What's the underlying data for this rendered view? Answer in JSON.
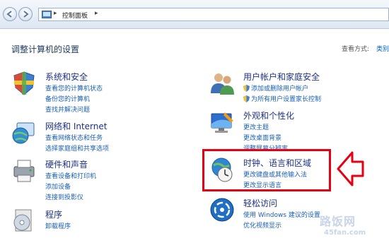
{
  "address": {
    "path": "控制面板",
    "separator": "▸"
  },
  "header": {
    "title": "调整计算机的设置",
    "view_by_label": "查看方式:",
    "view_by_value": "类别"
  },
  "categories": {
    "security": {
      "title": "系统和安全",
      "links": [
        "查看您的计算机状态",
        "备份您的计算机",
        "查找并解决问题"
      ]
    },
    "network": {
      "title": "网络和 Internet",
      "links": [
        "查看网络状态和任务",
        "选择家庭组和共享选项"
      ]
    },
    "hardware": {
      "title": "硬件和声音",
      "links": [
        "查看设备和打印机",
        "添加设备",
        "连接到投影仪"
      ]
    },
    "programs": {
      "title": "程序",
      "links": [
        "卸载程序"
      ]
    },
    "accounts": {
      "title": "用户帐户和家庭安全",
      "links": [
        "添加或删除用户帐户",
        "为所有用户设置家长控制"
      ]
    },
    "appearance": {
      "title": "外观和个性化",
      "links": [
        "更改主题",
        "更改桌面背景",
        "调整屏幕分辨率"
      ]
    },
    "clock": {
      "title": "时钟、语言和区域",
      "links": [
        "更改键盘或其他输入法",
        "更改显示语言"
      ]
    },
    "ease": {
      "title": "轻松访问",
      "links": [
        "使用 Windows 建议的设置",
        "优化视频显示"
      ]
    }
  },
  "watermark": {
    "line1": "路饭网",
    "line2": "45fan.com"
  },
  "colors": {
    "highlight": "#e60012",
    "link": "#1a5fb4",
    "title": "#1e3287"
  }
}
